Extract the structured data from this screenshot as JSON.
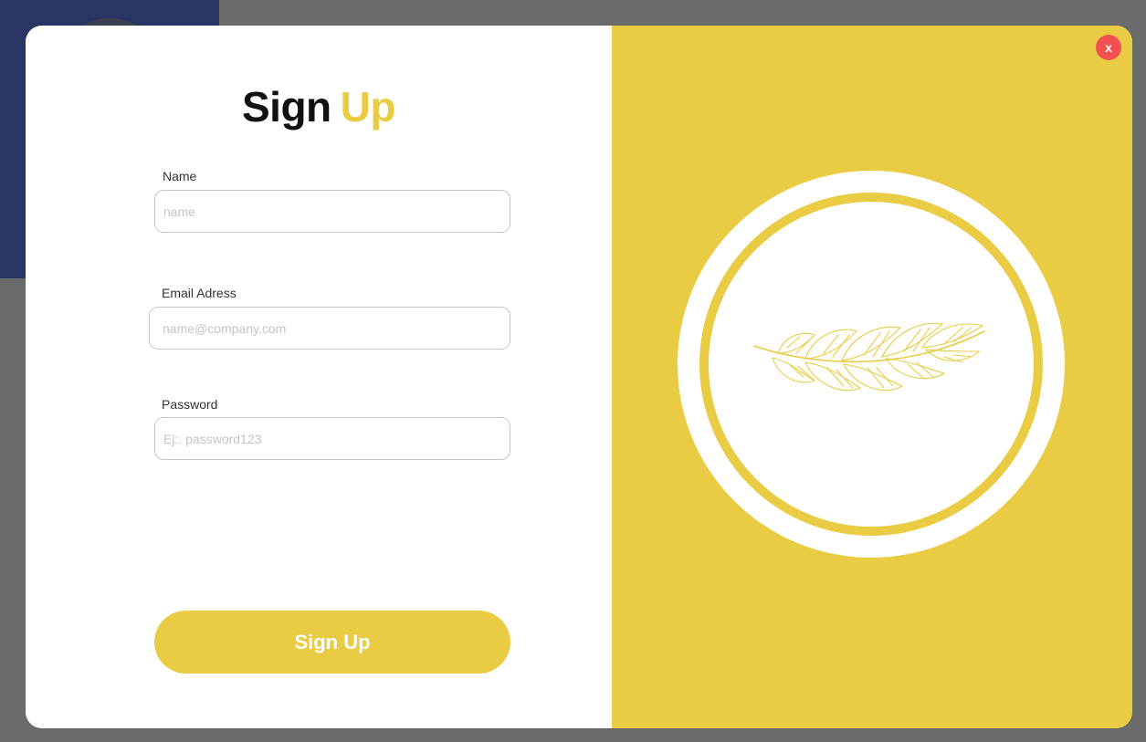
{
  "modal": {
    "title_part1": "Sign",
    "title_part2": "Up",
    "close_label": "x",
    "fields": {
      "name": {
        "label": "Name",
        "placeholder": "name",
        "value": ""
      },
      "email": {
        "label": "Email Adress",
        "placeholder": "name@company.com",
        "value": ""
      },
      "password": {
        "label": "Password",
        "placeholder": "Ej:. password123",
        "value": ""
      }
    },
    "submit_label": "Sign Up",
    "emblem_icon": "feather-icon"
  },
  "colors": {
    "accent": "#e9cb44",
    "close": "#f2514f",
    "backdrop": "#6b6b6b",
    "navy": "#2a3566"
  }
}
